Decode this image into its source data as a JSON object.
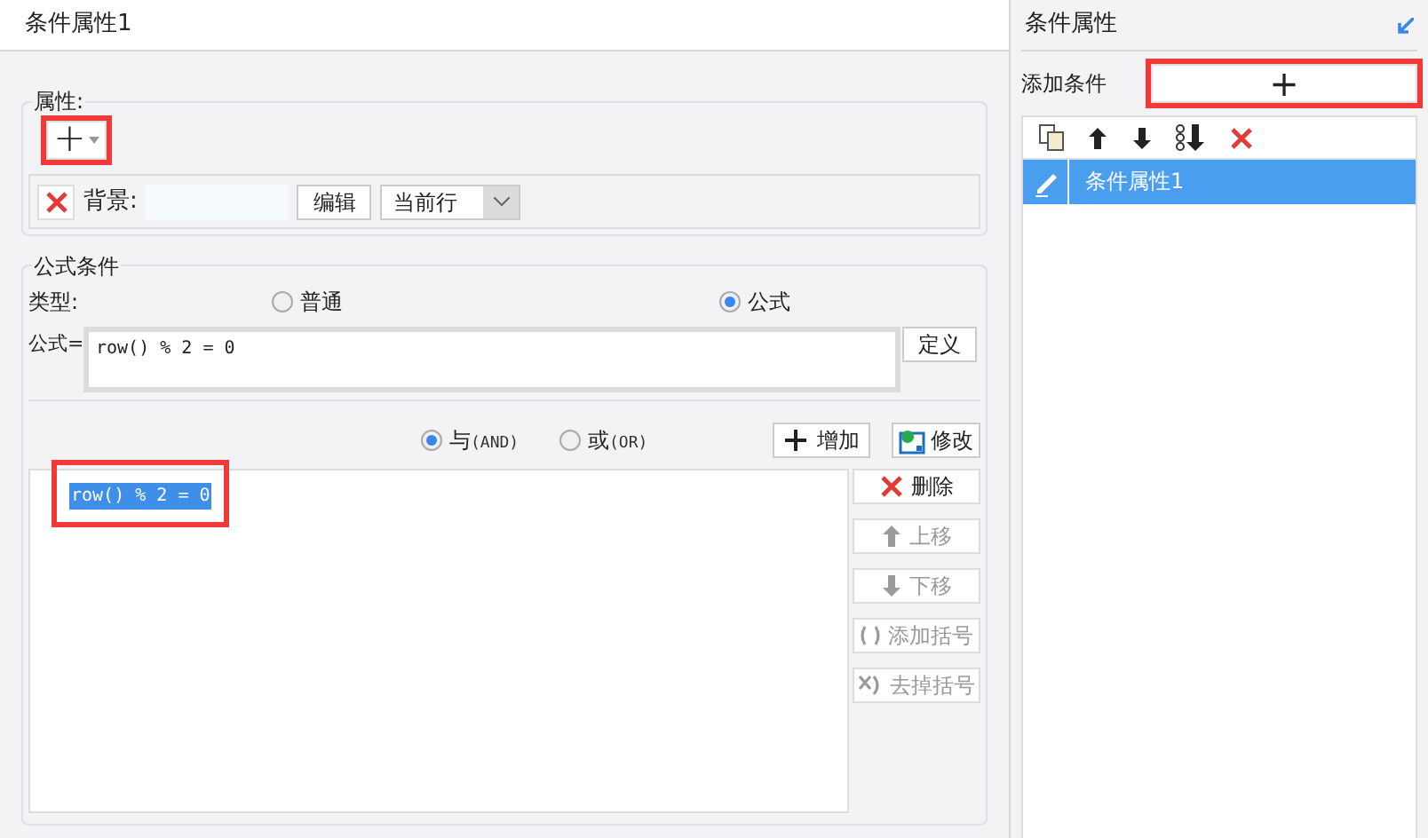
{
  "left_panel": {
    "title": "条件属性1",
    "properties": {
      "legend": "属性:",
      "add_button": {
        "label": "+",
        "highlighted": true
      },
      "items": [
        {
          "label": "背景:",
          "edit_button": "编辑",
          "scope": "当前行"
        }
      ]
    },
    "formula_conditions": {
      "legend": "公式条件",
      "type_label": "类型:",
      "types": [
        {
          "label": "普通",
          "selected": false
        },
        {
          "label": "公式",
          "selected": true
        }
      ],
      "formula_label": "公式=",
      "formula": "row() % 2 = 0",
      "define_button": "定义",
      "logic": [
        {
          "label": "与",
          "code": "(AND)",
          "selected": true
        },
        {
          "label": "或",
          "code": "(OR)",
          "selected": false
        }
      ],
      "add_button": "增加",
      "modify_button": "修改",
      "conditions": [
        {
          "text": "row() % 2 = 0",
          "selected": true,
          "highlighted": true
        }
      ],
      "side_buttons": [
        {
          "kind": "delete",
          "label": "删除",
          "disabled": false
        },
        {
          "kind": "up",
          "label": "上移",
          "disabled": true
        },
        {
          "kind": "down",
          "label": "下移",
          "disabled": true
        },
        {
          "kind": "add-brackets",
          "label": "添加括号",
          "disabled": true
        },
        {
          "kind": "remove-brackets",
          "label": "去掉括号",
          "disabled": true
        }
      ]
    }
  },
  "right_panel": {
    "title": "条件属性",
    "add_condition_label": "添加条件",
    "add_button": {
      "label": "+",
      "highlighted": true
    },
    "items": [
      {
        "label": "条件属性1",
        "selected": true
      }
    ]
  }
}
